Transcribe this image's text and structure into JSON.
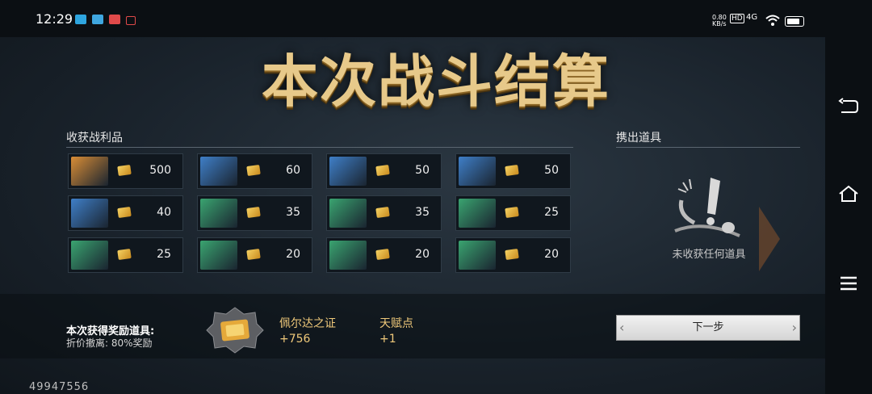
{
  "status_bar": {
    "time": "12:29",
    "net_speed": "0.80 KB/s",
    "hd_label": "HD",
    "network": "4G"
  },
  "title": "本次战斗结算",
  "loot_section": {
    "title": "收获战利品",
    "items": [
      {
        "value": "500",
        "color": "#d98d36"
      },
      {
        "value": "60",
        "color": "#3f7fc8"
      },
      {
        "value": "50",
        "color": "#3f7fc8"
      },
      {
        "value": "50",
        "color": "#3f7fc8"
      },
      {
        "value": "40",
        "color": "#3f7fc8"
      },
      {
        "value": "35",
        "color": "#3aa470"
      },
      {
        "value": "35",
        "color": "#3aa470"
      },
      {
        "value": "25",
        "color": "#3aa470"
      },
      {
        "value": "25",
        "color": "#3aa470"
      },
      {
        "value": "20",
        "color": "#3aa470"
      },
      {
        "value": "20",
        "color": "#3aa470"
      },
      {
        "value": "20",
        "color": "#3aa470"
      }
    ]
  },
  "carry_section": {
    "title": "携出道具",
    "empty_text": "未收获任何道具"
  },
  "reward": {
    "label": "本次获得奖励道具:",
    "discount": "折价撤离: 80%奖励",
    "item1_name": "佩尔达之证",
    "item1_value": "+756",
    "item2_name": "天赋点",
    "item2_value": "+1"
  },
  "next_button": "下一步",
  "player_id": "49947556",
  "nav": {
    "back_icon": "back-icon",
    "home_icon": "home-icon",
    "menu_icon": "menu-icon"
  }
}
